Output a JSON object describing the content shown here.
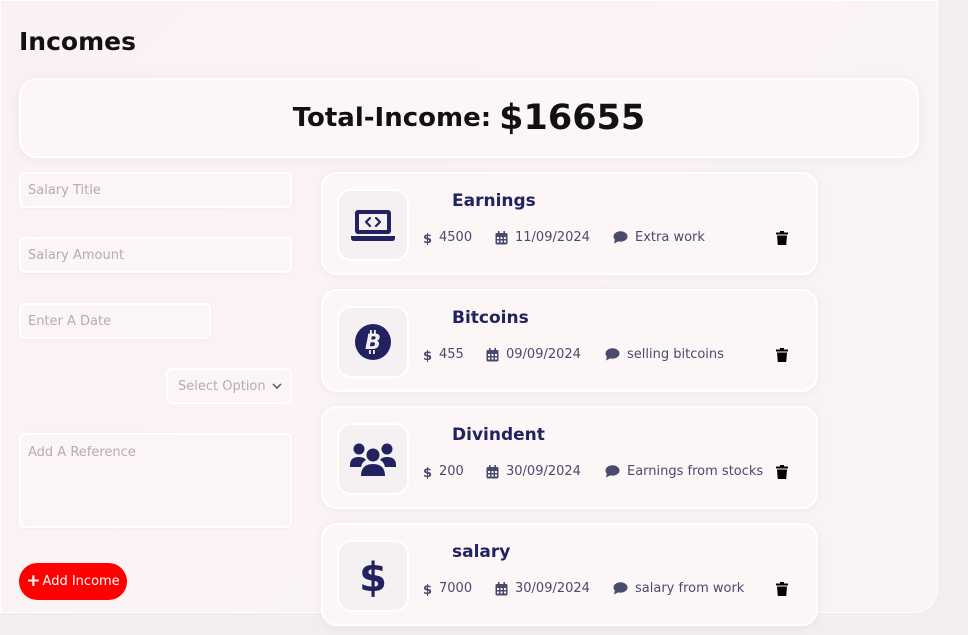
{
  "page": {
    "title": "Incomes"
  },
  "total": {
    "label": "Total-Income:",
    "value": "$16655"
  },
  "form": {
    "title_placeholder": "Salary Title",
    "amount_placeholder": "Salary Amount",
    "date_placeholder": "Enter A Date",
    "select_placeholder": "Select Option",
    "reference_placeholder": "Add A Reference",
    "add_button_label": "Add Income"
  },
  "incomes": [
    {
      "title": "Earnings",
      "amount": "4500",
      "date": "11/09/2024",
      "description": "Extra work",
      "icon": "laptop-code-icon"
    },
    {
      "title": "Bitcoins",
      "amount": "455",
      "date": "09/09/2024",
      "description": "selling bitcoins",
      "icon": "bitcoin-icon"
    },
    {
      "title": "Divindent",
      "amount": "200",
      "date": "30/09/2024",
      "description": "Earnings from stocks",
      "icon": "users-icon"
    },
    {
      "title": "salary",
      "amount": "7000",
      "date": "30/09/2024",
      "description": "salary from work",
      "icon": "dollar-icon"
    }
  ],
  "colors": {
    "accent": "#ff0000",
    "primary": "#222260",
    "text": "#4a4a6e"
  }
}
